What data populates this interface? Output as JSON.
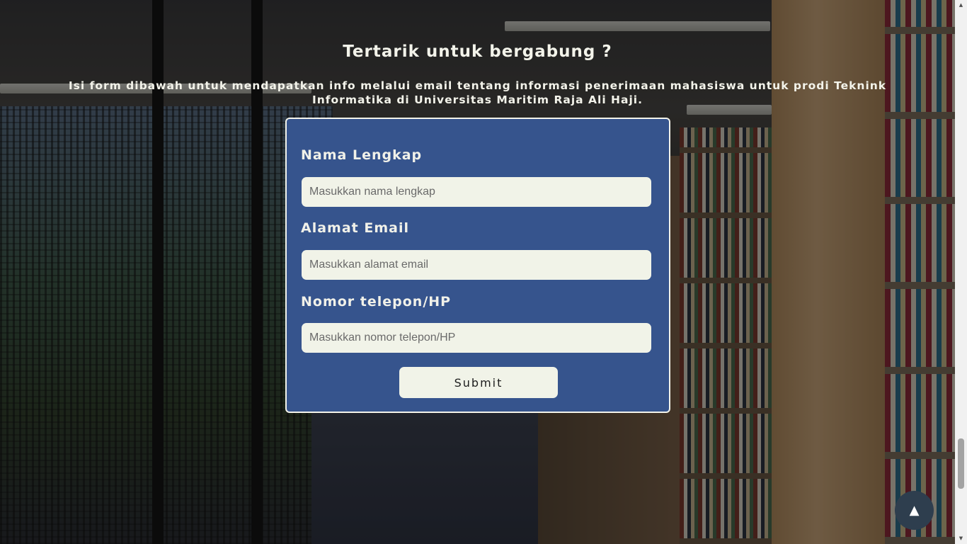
{
  "section": {
    "title": "Tertarik untuk bergabung ?",
    "description": "Isi form dibawah untuk mendapatkan info melalui email tentang informasi penerimaan mahasiswa untuk prodi Teknink Informatika di Universitas Maritim Raja Ali Haji."
  },
  "form": {
    "name_label": "Nama Lengkap",
    "name_placeholder": "Masukkan nama lengkap",
    "email_label": "Alamat Email",
    "email_placeholder": "Masukkan alamat email",
    "phone_label": "Nomor telepon/HP",
    "phone_placeholder": "Masukkan nomor telepon/HP",
    "submit_label": "Submit"
  },
  "back_to_top": {
    "icon": "arrow-up-icon",
    "glyph": "▲"
  },
  "colors": {
    "card_bg": "#36548d",
    "input_bg": "#f1f3e8",
    "text_light": "#f3f3ea",
    "back_to_top_bg": "#2e3e4e"
  }
}
